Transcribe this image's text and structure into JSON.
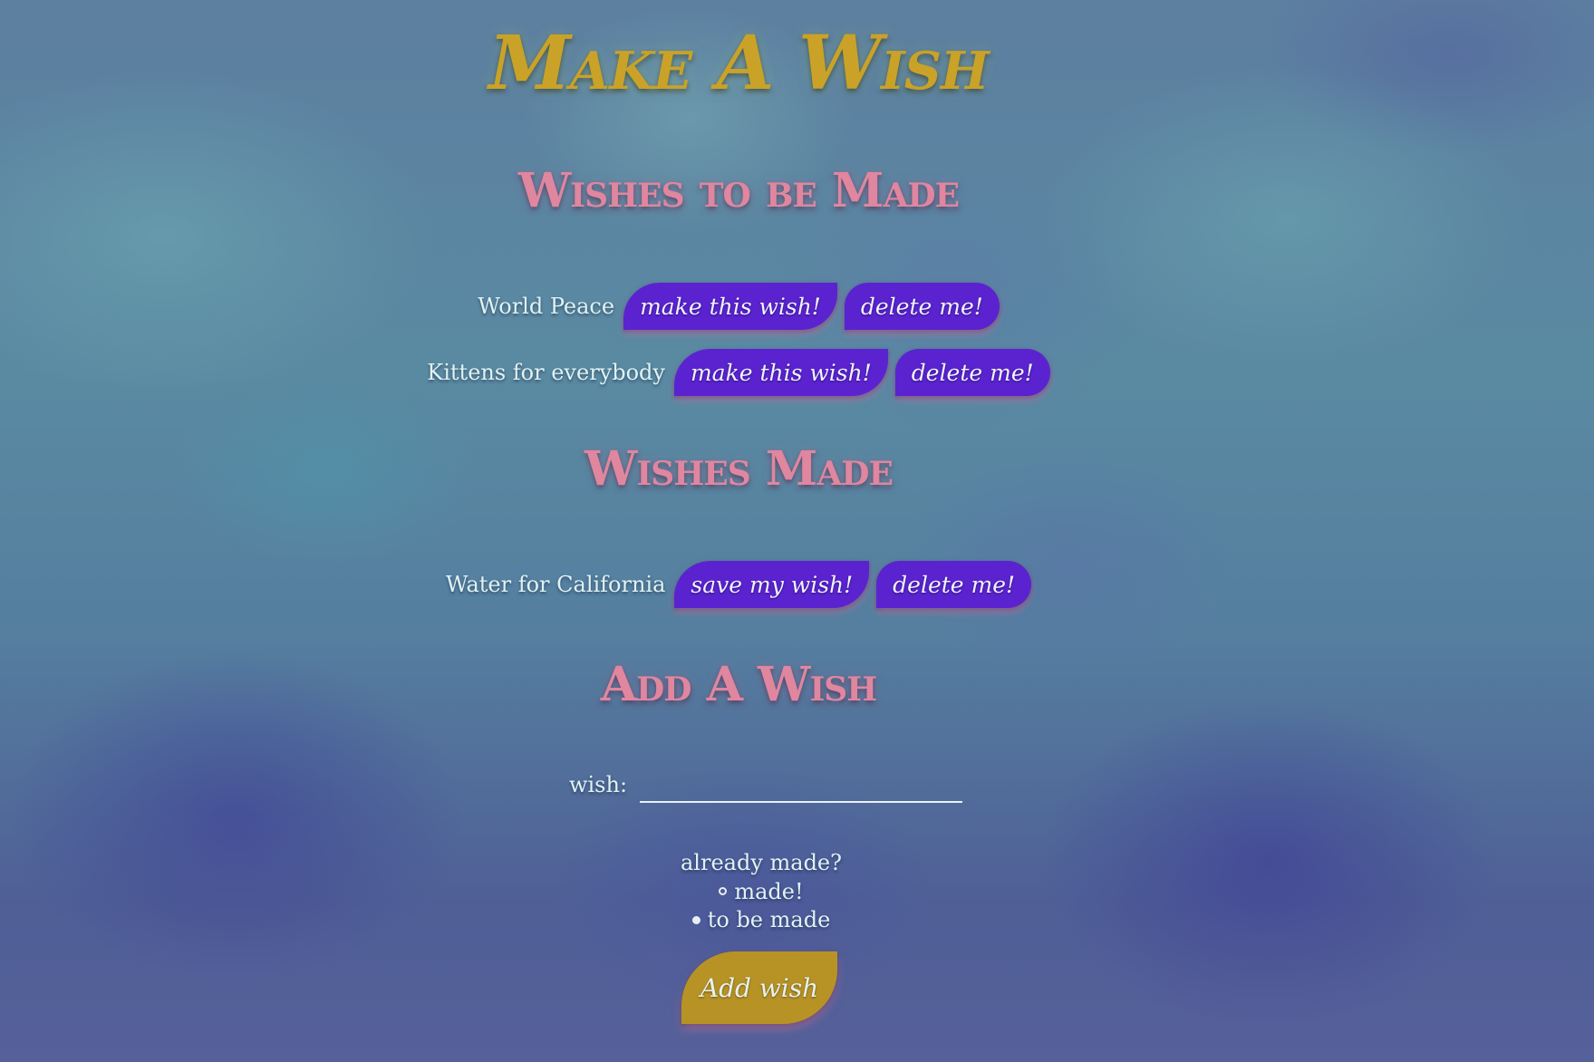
{
  "page": {
    "title": "Make A Wish"
  },
  "sections": {
    "to_be_made": {
      "heading": "Wishes to be Made",
      "wishes": [
        {
          "label": "World Peace",
          "primary_action": "make this wish!",
          "delete_action": "delete me!"
        },
        {
          "label": "Kittens for everybody",
          "primary_action": "make this wish!",
          "delete_action": "delete me!"
        }
      ]
    },
    "made": {
      "heading": "Wishes Made",
      "wishes": [
        {
          "label": "Water for California",
          "primary_action": "save my wish!",
          "delete_action": "delete me!"
        }
      ]
    },
    "add": {
      "heading": "Add A Wish",
      "wish_label": "wish:",
      "wish_value": "",
      "radio_question": "already made?",
      "options": [
        {
          "label": "made!",
          "selected": false
        },
        {
          "label": "to be made",
          "selected": true
        }
      ],
      "submit_label": "Add wish"
    }
  },
  "colors": {
    "title": "#c9a227",
    "heading": "#e0869f",
    "action_button": "#5a23cf",
    "submit_button": "#b79326",
    "text": "#dff3f4"
  }
}
